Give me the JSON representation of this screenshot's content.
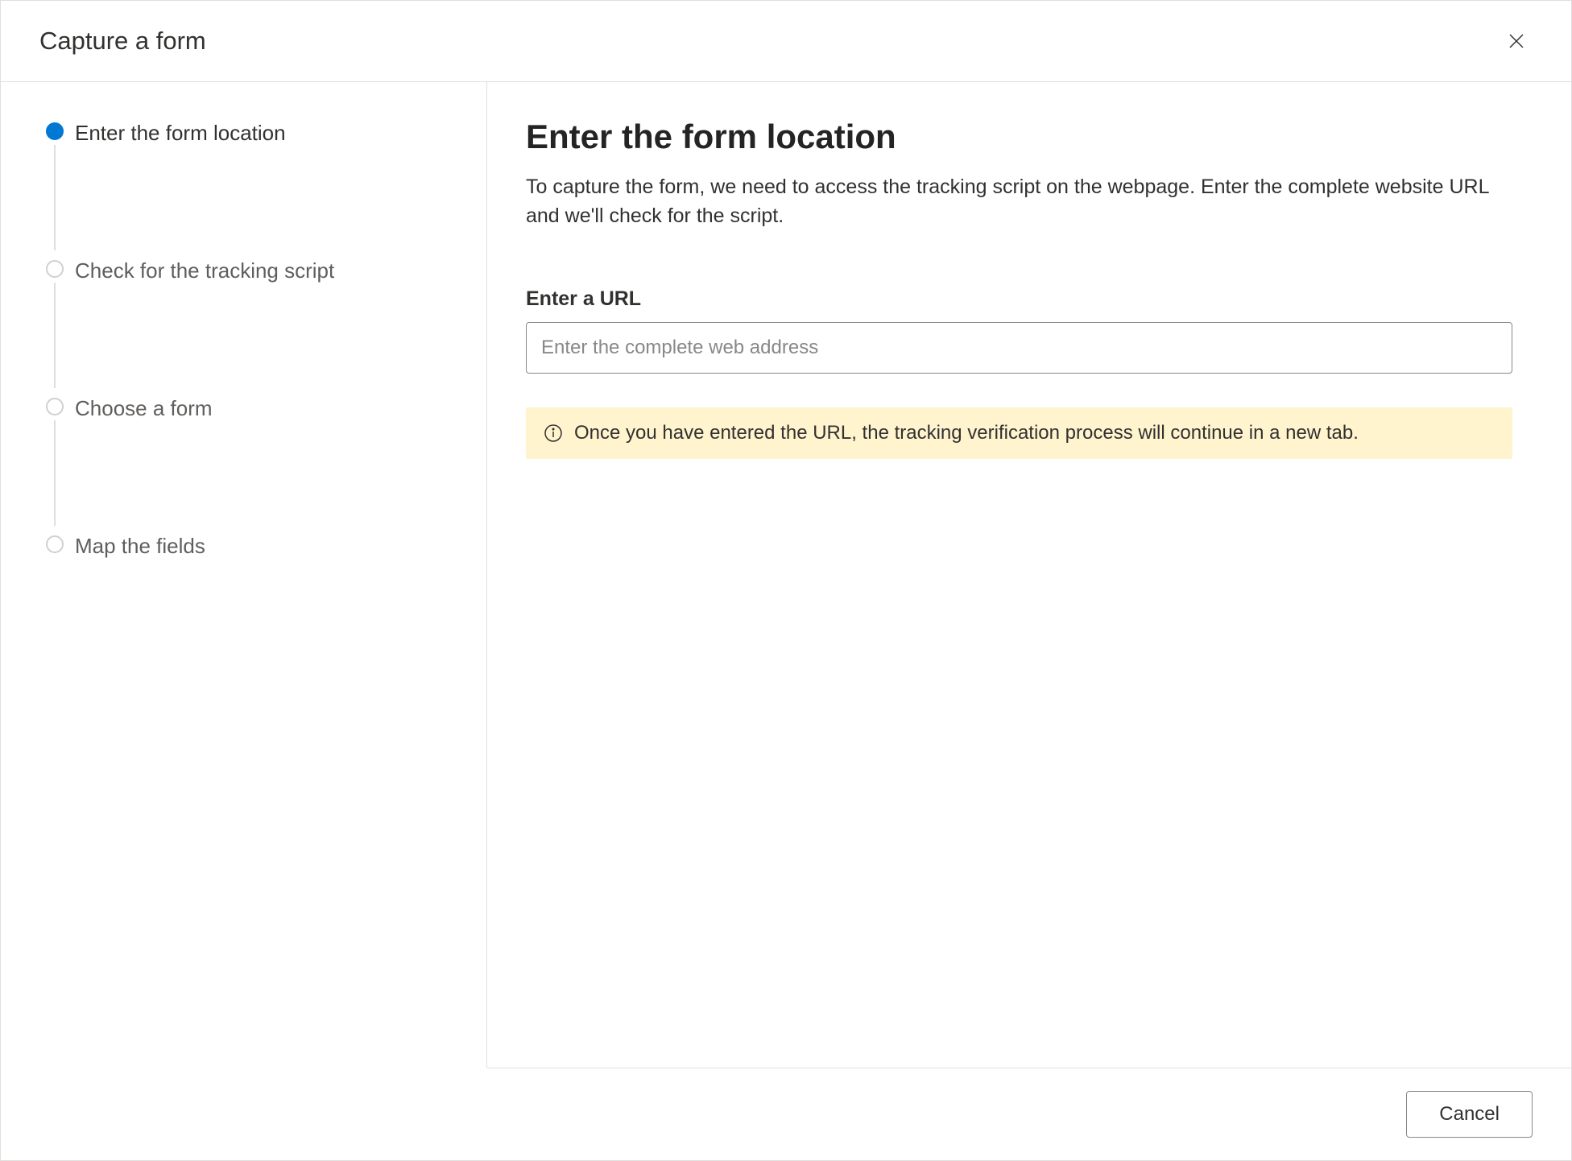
{
  "dialog": {
    "title": "Capture a form"
  },
  "steps": [
    {
      "label": "Enter the form location",
      "active": true
    },
    {
      "label": "Check for the tracking script",
      "active": false
    },
    {
      "label": "Choose a form",
      "active": false
    },
    {
      "label": "Map the fields",
      "active": false
    }
  ],
  "main": {
    "heading": "Enter the form location",
    "description": "To capture the form, we need to access the tracking script on the webpage. Enter the complete website URL and we'll check for the script.",
    "field_label": "Enter a URL",
    "url_placeholder": "Enter the complete web address",
    "url_value": "",
    "info_text": "Once you have entered the URL, the tracking verification process will continue in a new tab."
  },
  "footer": {
    "cancel_label": "Cancel"
  }
}
